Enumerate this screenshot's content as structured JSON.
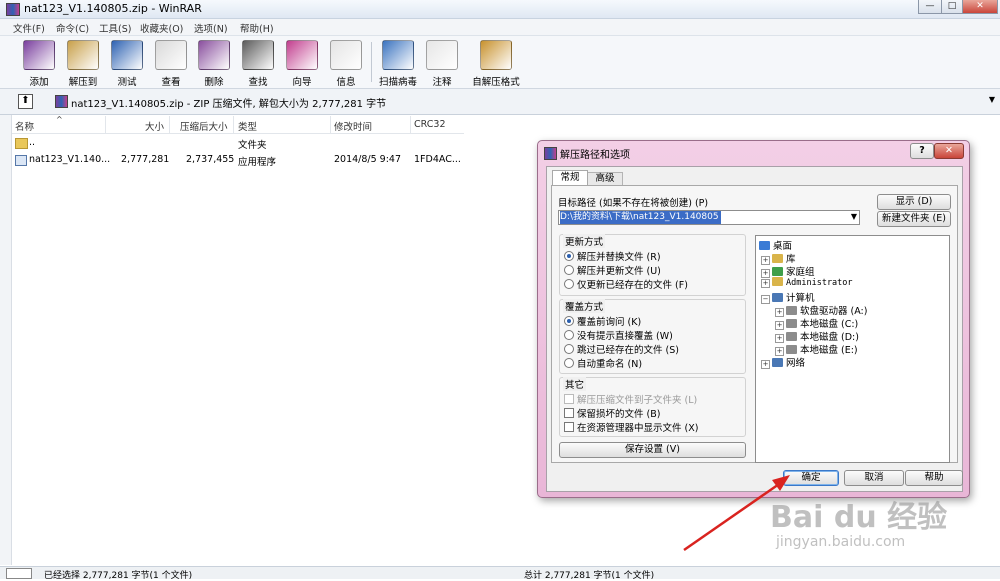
{
  "window": {
    "title": "nat123_V1.140805.zip - WinRAR"
  },
  "menu": [
    "文件(F)",
    "命令(C)",
    "工具(S)",
    "收藏夹(O)",
    "选项(N)",
    "帮助(H)"
  ],
  "toolbar": [
    {
      "label": "添加",
      "color": "#7a3f9e"
    },
    {
      "label": "解压到",
      "color": "#c8a04a"
    },
    {
      "label": "测试",
      "color": "#2f63b3"
    },
    {
      "label": "查看",
      "color": "#d9d9d9"
    },
    {
      "label": "删除",
      "color": "#8a4f9e"
    },
    {
      "label": "查找",
      "color": "#5c5c5c"
    },
    {
      "label": "向导",
      "color": "#c23f8f"
    },
    {
      "label": "信息",
      "color": "#e4e4e4"
    },
    {
      "label": "扫描病毒",
      "color": "#3c74c0"
    },
    {
      "label": "注释",
      "color": "#e6e6e6"
    },
    {
      "label": "自解压格式",
      "color": "#c8922e"
    }
  ],
  "address": {
    "text": "nat123_V1.140805.zip - ZIP 压缩文件, 解包大小为 2,777,281 字节"
  },
  "list": {
    "columns": [
      "名称",
      "大小",
      "压缩后大小",
      "类型",
      "修改时间",
      "CRC32"
    ],
    "rows": [
      {
        "name": "..",
        "size": "",
        "packed": "",
        "type": "文件夹",
        "modified": "",
        "crc": ""
      },
      {
        "name": "nat123_V1.140...",
        "size": "2,777,281",
        "packed": "2,737,455",
        "type": "应用程序",
        "modified": "2014/8/5 9:47",
        "crc": "1FD4AC..."
      }
    ]
  },
  "status": {
    "left": "已经选择 2,777,281 字节(1 个文件)",
    "right": "总计 2,777,281 字节(1 个文件)"
  },
  "dialog": {
    "title": "解压路径和选项",
    "help_glyph": "?",
    "close_glyph": "✕",
    "tabs": [
      "常规",
      "高级"
    ],
    "dest_label": "目标路径 (如果不存在将被创建) (P)",
    "dest_value": "D:\\我的资料\\下载\\nat123_V1.140805",
    "show_button": "显示 (D)",
    "newfolder_button": "新建文件夹 (E)",
    "update_title": "更新方式",
    "update_options": [
      "解压并替换文件 (R)",
      "解压并更新文件 (U)",
      "仅更新已经存在的文件 (F)"
    ],
    "overwrite_title": "覆盖方式",
    "overwrite_options": [
      "覆盖前询问 (K)",
      "没有提示直接覆盖 (W)",
      "跳过已经存在的文件 (S)",
      "自动重命名 (N)"
    ],
    "misc_title": "其它",
    "misc_options": [
      "解压压缩文件到子文件夹 (L)",
      "保留损坏的文件 (B)",
      "在资源管理器中显示文件 (X)"
    ],
    "save_button": "保存设置 (V)",
    "tree": [
      {
        "label": "桌面",
        "level": 0,
        "expander": "",
        "color": "#3a7bd5"
      },
      {
        "label": "库",
        "level": 1,
        "expander": "+",
        "color": "#d9b44a"
      },
      {
        "label": "家庭组",
        "level": 1,
        "expander": "+",
        "color": "#3f9e4a"
      },
      {
        "label": "Administrator",
        "level": 1,
        "expander": "+",
        "color": "#d9b44a"
      },
      {
        "label": "计算机",
        "level": 1,
        "expander": "−",
        "color": "#4a78b5"
      },
      {
        "label": "软盘驱动器 (A:)",
        "level": 2,
        "expander": "+",
        "color": "#8c8c8c"
      },
      {
        "label": "本地磁盘 (C:)",
        "level": 2,
        "expander": "+",
        "color": "#8c8c8c"
      },
      {
        "label": "本地磁盘 (D:)",
        "level": 2,
        "expander": "+",
        "color": "#8c8c8c"
      },
      {
        "label": "本地磁盘 (E:)",
        "level": 2,
        "expander": "+",
        "color": "#8c8c8c"
      },
      {
        "label": "网络",
        "level": 1,
        "expander": "+",
        "color": "#4a78b5"
      }
    ],
    "ok_button": "确定",
    "cancel_button": "取消",
    "help_button": "帮助"
  },
  "watermark": {
    "brand": "Bai du 经验",
    "url": "jingyan.baidu.com"
  }
}
